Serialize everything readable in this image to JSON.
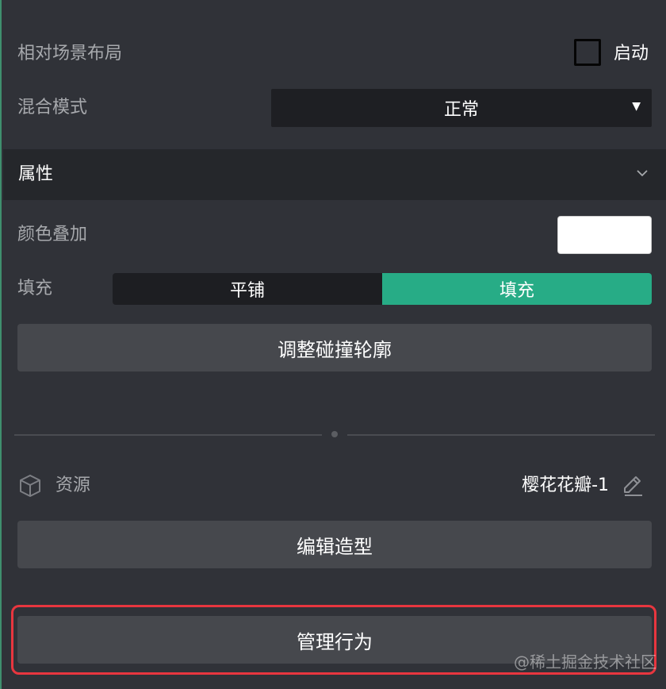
{
  "layout_row": {
    "label": "相对场景布局",
    "checkbox_label": "启动",
    "checked": false
  },
  "blend_row": {
    "label": "混合模式",
    "value": "正常"
  },
  "section": {
    "title": "属性"
  },
  "color_row": {
    "label": "颜色叠加",
    "color": "#ffffff"
  },
  "fill_row": {
    "label": "填充",
    "options": [
      "平铺",
      "填充"
    ],
    "selected": "填充"
  },
  "buttons": {
    "adjust_collision": "调整碰撞轮廓",
    "edit_model": "编辑造型",
    "manage_behavior": "管理行为"
  },
  "resource": {
    "label": "资源",
    "name": "樱花花瓣-1"
  },
  "icons": {
    "caret": "caret-down-icon",
    "chevron": "chevron-down-icon",
    "cube": "cube-icon",
    "edit": "edit-icon"
  },
  "colors": {
    "accent": "#27ac86",
    "highlight": "#e8363f"
  },
  "watermark": "@稀土掘金技术社区"
}
